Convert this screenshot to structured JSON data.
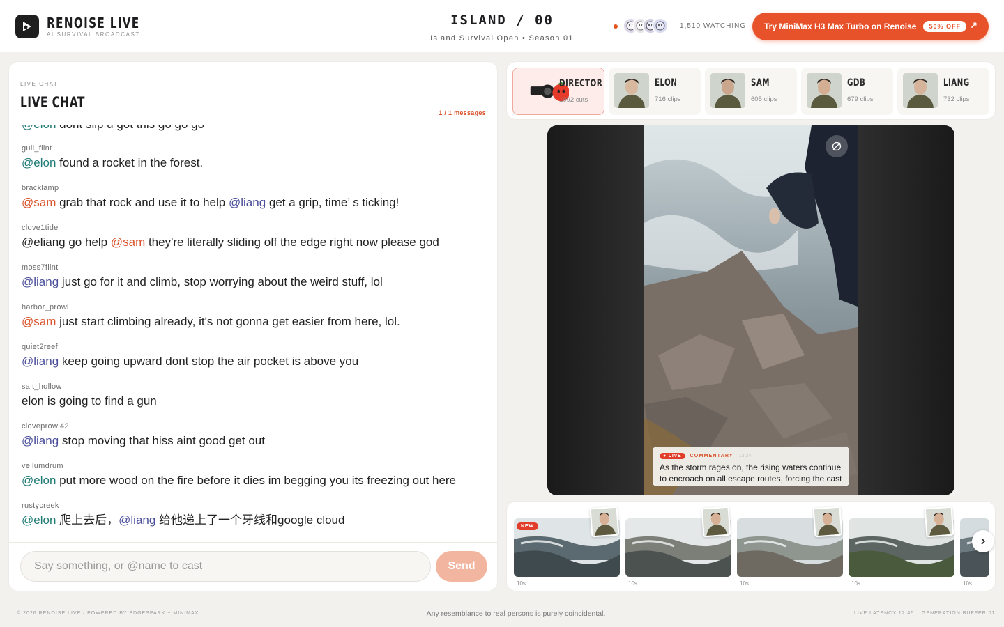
{
  "header": {
    "brand_name": "RENOISE LIVE",
    "brand_sub": "AI SURVIVAL BROADCAST",
    "title": "ISLAND / 00",
    "subtitle": "Island Survival Open  •  Season 01",
    "watching": "1,510 WATCHING",
    "promo_label": "Try MiniMax H3 Max Turbo on Renoise",
    "promo_badge": "50% OFF",
    "promo_arrow": "↗",
    "accent_color": "#e8522a"
  },
  "chat": {
    "kicker": "LIVE CHAT",
    "title": "LIVE CHAT",
    "count": "1 / 1 messages",
    "first_mention": "@elon",
    "first_text": " dont slip u got this go go go",
    "messages": [
      {
        "user": "gull_flint",
        "parts": [
          {
            "m": "elon",
            "t": "@elon"
          },
          {
            "t": " found a rocket in the forest."
          }
        ]
      },
      {
        "user": "bracklamp",
        "parts": [
          {
            "m": "sam",
            "t": "@sam"
          },
          {
            "t": " grab that rock and use it to help "
          },
          {
            "m": "liang",
            "t": "@liang"
          },
          {
            "t": " get a grip, time’ s ticking!"
          }
        ]
      },
      {
        "user": "clove1tide",
        "parts": [
          {
            "t": "@eliang go help "
          },
          {
            "m": "sam",
            "t": "@sam"
          },
          {
            "t": " they're literally sliding off the edge right now please god"
          }
        ]
      },
      {
        "user": "moss7flint",
        "parts": [
          {
            "m": "liang",
            "t": "@liang"
          },
          {
            "t": " just go for it and climb, stop worrying about the weird stuff, lol"
          }
        ]
      },
      {
        "user": "harbor_prowl",
        "parts": [
          {
            "m": "sam",
            "t": "@sam"
          },
          {
            "t": " just start climbing already, it's not gonna get easier from here, lol."
          }
        ]
      },
      {
        "user": "quiet2reef",
        "parts": [
          {
            "m": "liang",
            "t": "@liang"
          },
          {
            "t": " keep going upward dont stop the air pocket is above you"
          }
        ]
      },
      {
        "user": "salt_hollow",
        "parts": [
          {
            "t": "elon is going to find a gun"
          }
        ]
      },
      {
        "user": "cloveprowl42",
        "parts": [
          {
            "m": "liang",
            "t": "@liang"
          },
          {
            "t": " stop moving that hiss aint good get out"
          }
        ]
      },
      {
        "user": "vellumdrum",
        "parts": [
          {
            "m": "elon",
            "t": "@elon"
          },
          {
            "t": " put more wood on the fire before it dies im begging you its freezing out here"
          }
        ]
      },
      {
        "user": "rustycreek",
        "parts": [
          {
            "m": "elon",
            "t": "@elon"
          },
          {
            "t": " 爬上去后，"
          },
          {
            "m": "liang",
            "t": "@liang"
          },
          {
            "t": " 给他递上了一个牙线和google cloud"
          }
        ]
      }
    ],
    "input_placeholder": "Say something, or @name to cast",
    "send_label": "Send"
  },
  "cast": [
    {
      "name": "DIRECTOR",
      "meta": "1092 cuts",
      "active": true
    },
    {
      "name": "ELON",
      "meta": "716 clips",
      "active": false
    },
    {
      "name": "SAM",
      "meta": "605 clips",
      "active": false
    },
    {
      "name": "GDB",
      "meta": "679 clips",
      "active": false
    },
    {
      "name": "LIANG",
      "meta": "732 clips",
      "active": false
    }
  ],
  "commentary": {
    "live": "● LIVE",
    "kicker": "COMMENTARY",
    "time": "13:24",
    "text": "As the storm rages on, the rising waters continue to encroach on all escape routes, forcing the cast to climb."
  },
  "clips": [
    {
      "duration": "10s",
      "badge": "NEW"
    },
    {
      "duration": "10s",
      "badge": ""
    },
    {
      "duration": "10s",
      "badge": ""
    },
    {
      "duration": "10s",
      "badge": ""
    },
    {
      "duration": "10s",
      "badge": ""
    }
  ],
  "footer": {
    "left": "© 2026 RENOISE LIVE / POWERED BY EDGESPARK + MINIMAX",
    "center": "Any resemblance to real persons is purely coincidental.",
    "latency": "LIVE LATENCY 12.45",
    "buffer": "GENERATION BUFFER 01"
  }
}
